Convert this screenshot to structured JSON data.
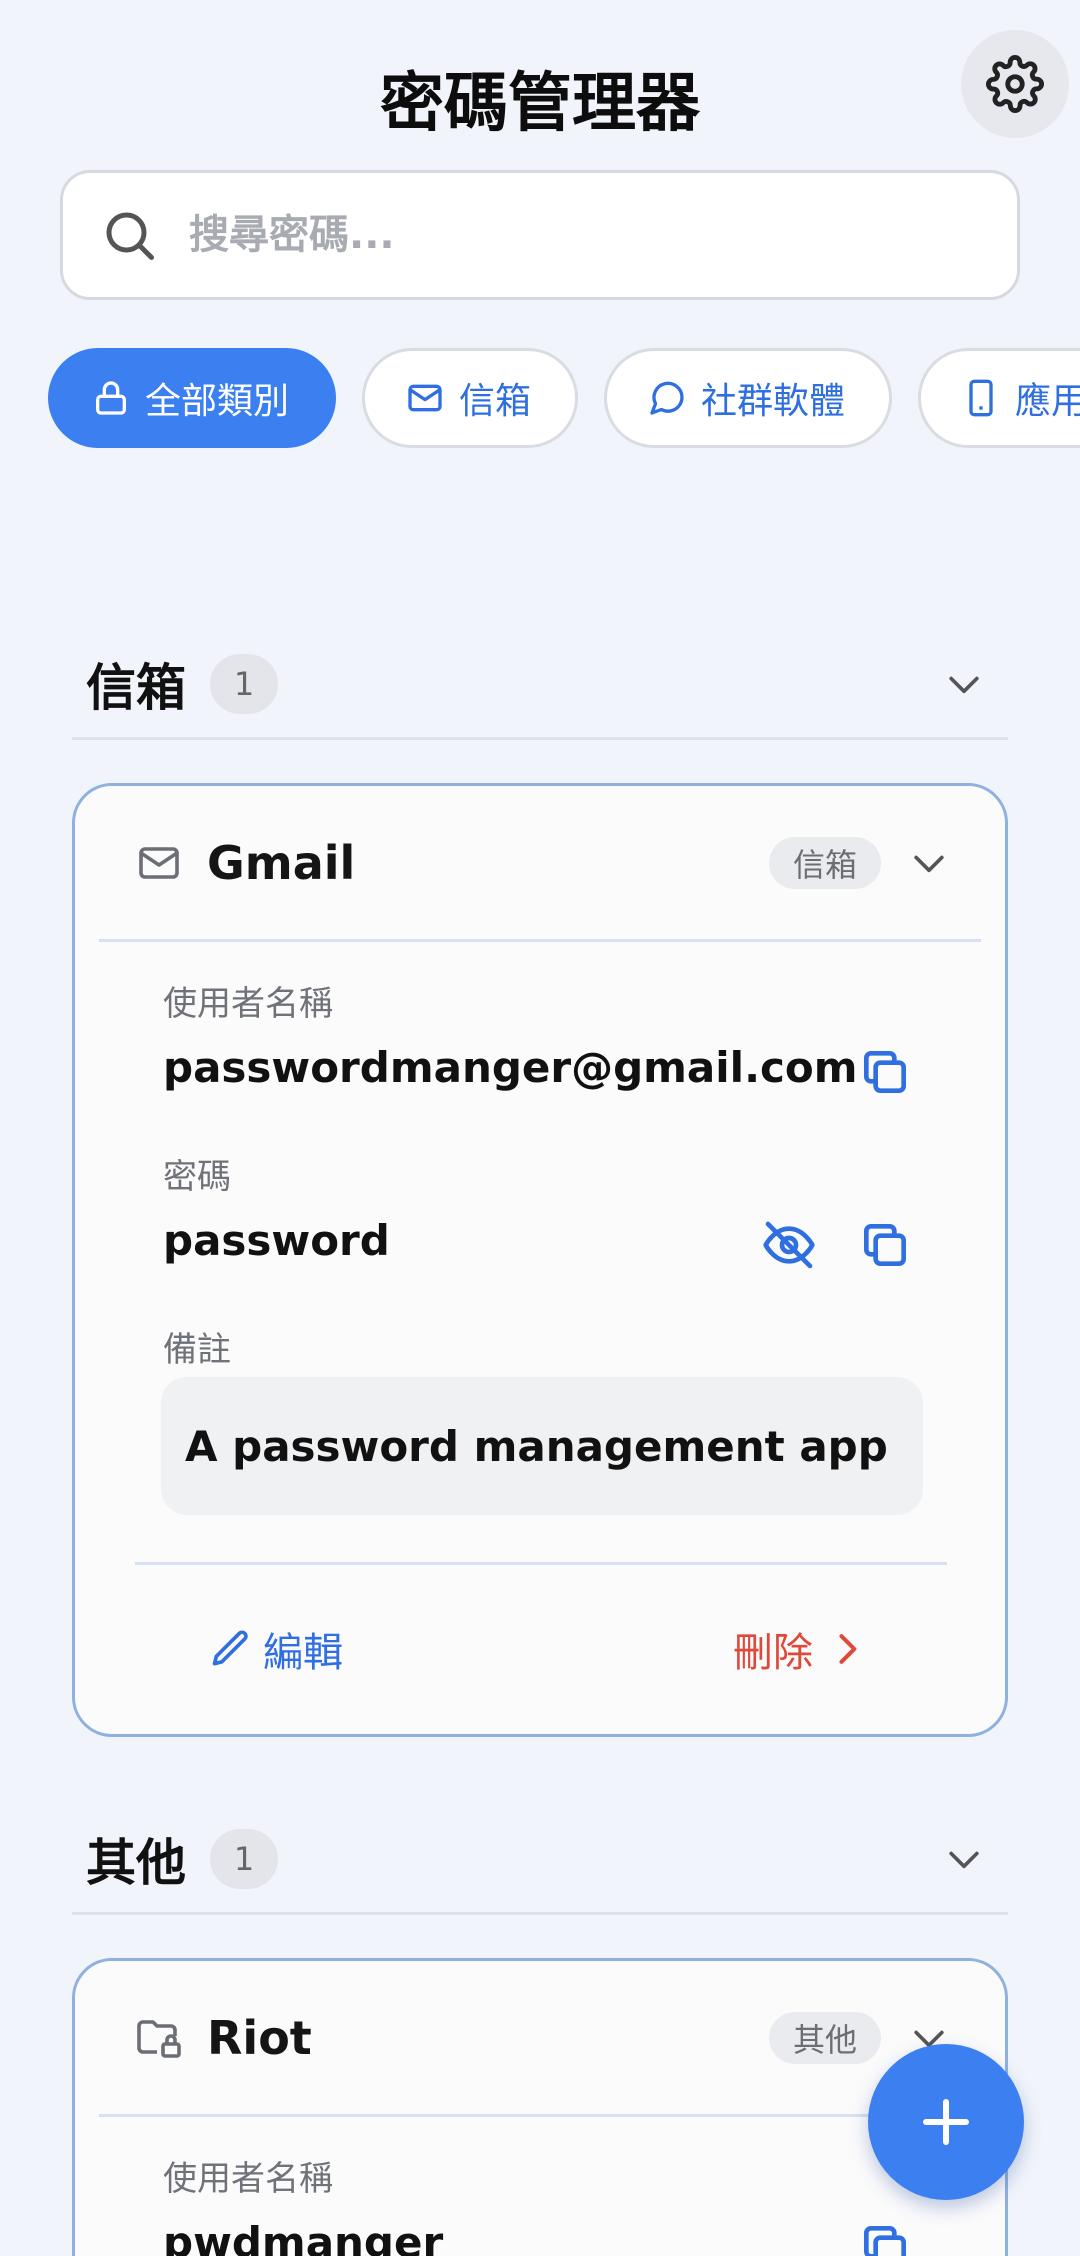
{
  "header": {
    "title": "密碼管理器"
  },
  "search": {
    "placeholder": "搜尋密碼..."
  },
  "categories": [
    {
      "label": "全部類別",
      "icon": "lock-icon",
      "active": true
    },
    {
      "label": "信箱",
      "icon": "mail-icon",
      "active": false
    },
    {
      "label": "社群軟體",
      "icon": "chat-icon",
      "active": false
    },
    {
      "label": "應用",
      "icon": "phone-icon",
      "active": false
    }
  ],
  "sections": [
    {
      "name": "信箱",
      "count": "1",
      "entry": {
        "service": "Gmail",
        "tag": "信箱",
        "username_label": "使用者名稱",
        "username": "passwordmanger@gmail.com",
        "password_label": "密碼",
        "password": "password",
        "note_label": "備註",
        "note": "A password management app",
        "edit_label": "編輯",
        "delete_label": "刪除"
      }
    },
    {
      "name": "其他",
      "count": "1",
      "entry": {
        "service": "Riot",
        "tag": "其他",
        "username_label": "使用者名稱",
        "username": "pwdmanger"
      }
    }
  ],
  "colors": {
    "accent": "#3b7ff0",
    "danger": "#e0483a",
    "card_border": "#8eb1e0",
    "background": "#f1f4fa"
  }
}
